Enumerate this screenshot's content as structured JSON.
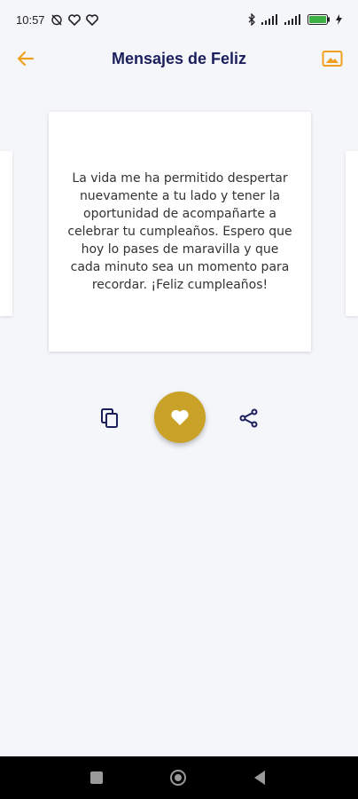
{
  "status_bar": {
    "time": "10:57",
    "left_icons": [
      "alarm-off-icon",
      "heart-outline-icon",
      "heart-outline-icon"
    ],
    "right_icons": [
      "bluetooth-icon",
      "signal-icon",
      "signal-icon",
      "battery-icon",
      "charging-icon"
    ]
  },
  "app_bar": {
    "title": "Mensajes de Feliz",
    "back_icon": "arrow-left-icon",
    "image_icon": "image-icon",
    "accent_color": "#f0a020"
  },
  "card": {
    "message": "La vida me ha permitido despertar nuevamente a tu lado y tener la oportunidad de acompañarte a celebrar tu cumpleaños. Espero que hoy lo pases de maravilla y que cada minuto sea un momento para recordar. ¡Feliz cumpleaños!"
  },
  "actions": {
    "copy_icon": "copy-icon",
    "favorite_icon": "heart-icon",
    "share_icon": "share-icon",
    "favorite_color": "#c9a227",
    "icon_color": "#1b1f5c"
  },
  "nav_bar": {
    "buttons": [
      "recents-icon",
      "home-icon",
      "back-icon"
    ]
  }
}
